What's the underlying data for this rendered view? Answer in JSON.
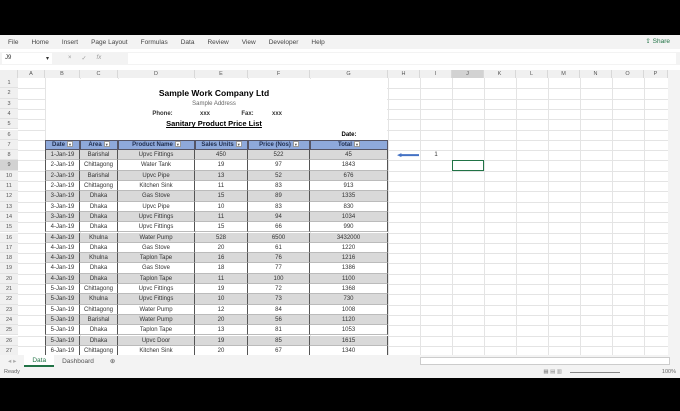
{
  "menu": [
    "File",
    "Home",
    "Insert",
    "Page Layout",
    "Formulas",
    "Data",
    "Review",
    "View",
    "Developer",
    "Help"
  ],
  "share_label": "Share",
  "name_box": "J9",
  "fx_symbols": [
    "×",
    "✓",
    "fx"
  ],
  "columns": [
    "A",
    "B",
    "C",
    "D",
    "E",
    "F",
    "G",
    "H",
    "I",
    "J",
    "K",
    "L",
    "M",
    "N",
    "O",
    "P"
  ],
  "company": "Sample Work Company Ltd",
  "address": "Sample Address",
  "phone_label": "Phone:",
  "phone": "xxx",
  "fax_label": "Fax:",
  "fax": "xxx",
  "list_title": "Sanitary Product Price List",
  "date_label": "Date:",
  "headers": [
    "Date",
    "Area",
    "Product Name",
    "Sales Units",
    "Price (Nos)",
    "Total"
  ],
  "rows": [
    [
      "1-Jan-19",
      "Barishal",
      "Upvc Fittings",
      "450",
      "522",
      "45"
    ],
    [
      "2-Jan-19",
      "Chittagong",
      "Water Tank",
      "19",
      "97",
      "1843"
    ],
    [
      "2-Jan-19",
      "Barishal",
      "Upvc Pipe",
      "13",
      "52",
      "676"
    ],
    [
      "2-Jan-19",
      "Chittagong",
      "Kitchen Sink",
      "11",
      "83",
      "913"
    ],
    [
      "3-Jan-19",
      "Dhaka",
      "Gas Stove",
      "15",
      "89",
      "1335"
    ],
    [
      "3-Jan-19",
      "Dhaka",
      "Upvc Pipe",
      "10",
      "83",
      "830"
    ],
    [
      "3-Jan-19",
      "Dhaka",
      "Upvc Fittings",
      "11",
      "94",
      "1034"
    ],
    [
      "4-Jan-19",
      "Dhaka",
      "Upvc Fittings",
      "15",
      "66",
      "990"
    ],
    [
      "4-Jan-19",
      "Khulna",
      "Water Pump",
      "528",
      "6500",
      "3432000"
    ],
    [
      "4-Jan-19",
      "Dhaka",
      "Gas Stove",
      "20",
      "61",
      "1220"
    ],
    [
      "4-Jan-19",
      "Khulna",
      "Taplon Tape",
      "16",
      "76",
      "1216"
    ],
    [
      "4-Jan-19",
      "Dhaka",
      "Gas Stove",
      "18",
      "77",
      "1386"
    ],
    [
      "4-Jan-19",
      "Dhaka",
      "Taplon Tape",
      "11",
      "100",
      "1100"
    ],
    [
      "5-Jan-19",
      "Chittagong",
      "Upvc Fittings",
      "19",
      "72",
      "1368"
    ],
    [
      "5-Jan-19",
      "Khulna",
      "Upvc Fittings",
      "10",
      "73",
      "730"
    ],
    [
      "5-Jan-19",
      "Chittagong",
      "Water Pump",
      "12",
      "84",
      "1008"
    ],
    [
      "5-Jan-19",
      "Barishal",
      "Water Pump",
      "20",
      "56",
      "1120"
    ],
    [
      "5-Jan-19",
      "Dhaka",
      "Taplon Tape",
      "13",
      "81",
      "1053"
    ],
    [
      "5-Jan-19",
      "Dhaka",
      "Upvc Door",
      "19",
      "85",
      "1615"
    ],
    [
      "6-Jan-19",
      "Chittagong",
      "Kitchen Sink",
      "20",
      "67",
      "1340"
    ]
  ],
  "side_value": "1",
  "sheets": [
    "Data",
    "Dashboard"
  ],
  "status": "Ready",
  "zoom": "100%",
  "colors": {
    "header": "#8ea9db",
    "stripe": "#d9d9d9",
    "accent": "#217346",
    "arrow": "#4472c4"
  }
}
